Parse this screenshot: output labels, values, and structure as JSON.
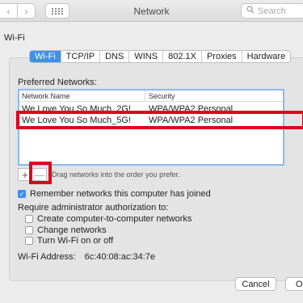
{
  "window": {
    "title": "Network"
  },
  "toolbar": {
    "back_glyph": "‹",
    "forward_glyph": "›",
    "grid_icon": "grid-icon",
    "search_placeholder": "Search"
  },
  "section_title": "Wi-Fi",
  "tabs": [
    {
      "label": "Wi-Fi",
      "active": true
    },
    {
      "label": "TCP/IP",
      "active": false
    },
    {
      "label": "DNS",
      "active": false
    },
    {
      "label": "WINS",
      "active": false
    },
    {
      "label": "802.1X",
      "active": false
    },
    {
      "label": "Proxies",
      "active": false
    },
    {
      "label": "Hardware",
      "active": false
    }
  ],
  "preferred": {
    "label": "Preferred Networks:",
    "columns": [
      "Network Name",
      "Security"
    ],
    "rows": [
      {
        "name": "We Love You So Much_2G!",
        "security": "WPA/WPA2 Personal"
      },
      {
        "name": "We Love You So Much_5G!",
        "security": "WPA/WPA2 Personal"
      }
    ]
  },
  "list_controls": {
    "add_label": "+",
    "remove_label": "—",
    "hint": "Drag networks into the order you prefer."
  },
  "remember": {
    "label": "Remember networks this computer has joined",
    "checked": true
  },
  "require_admin": {
    "label": "Require administrator authorization to:",
    "options": [
      {
        "label": "Create computer-to-computer networks",
        "checked": false
      },
      {
        "label": "Change networks",
        "checked": false
      },
      {
        "label": "Turn Wi-Fi on or off",
        "checked": false
      }
    ]
  },
  "wifi_address": {
    "label": "Wi-Fi Address:",
    "value": "6c:40:08:ac:34:7e"
  },
  "buttons": {
    "cancel": "Cancel",
    "ok": "OK"
  },
  "colors": {
    "accent": "#3d8ff2",
    "highlight": "#e0001b"
  }
}
